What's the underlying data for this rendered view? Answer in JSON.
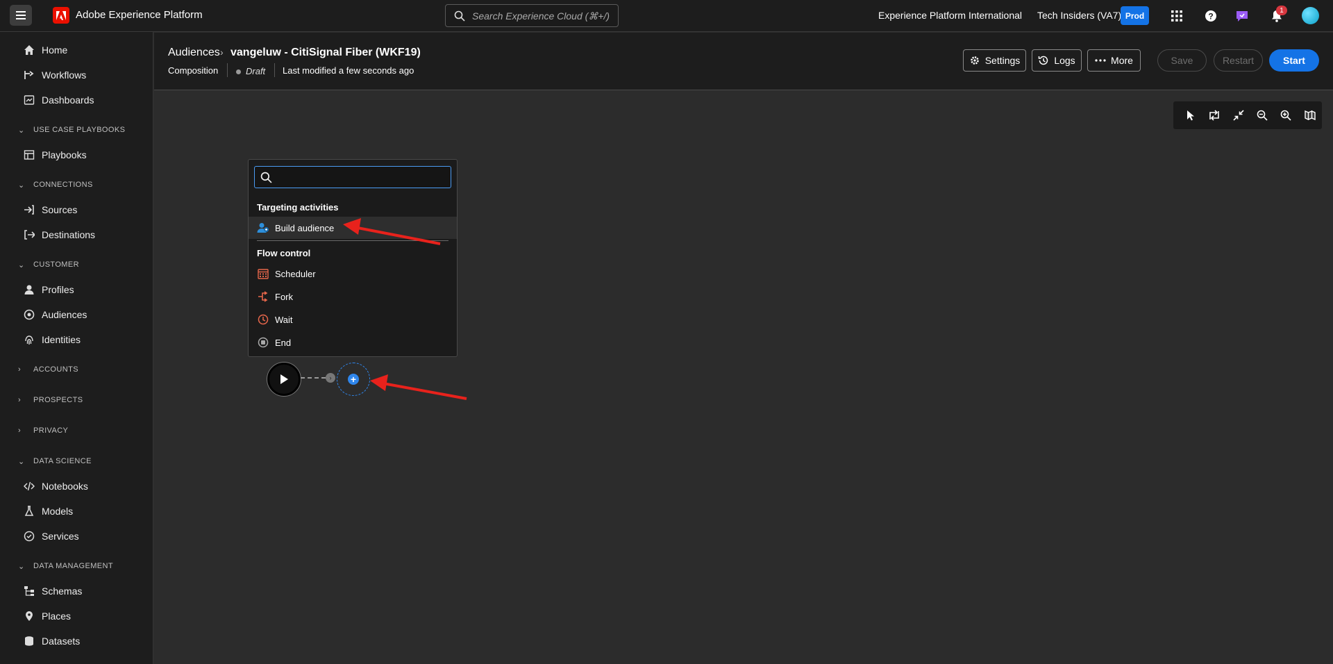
{
  "app": {
    "brand": "Adobe Experience Platform",
    "search_placeholder": "Search Experience Cloud (⌘+/)",
    "org": "Experience Platform International",
    "sandbox": "Tech Insiders (VA7)",
    "env_badge": "Prod",
    "notification_count": "1",
    "brand_color": "#eb1000",
    "accent_color": "#1473e6"
  },
  "sidebar": {
    "items": [
      {
        "label": "Home",
        "icon": "home-icon"
      },
      {
        "label": "Workflows",
        "icon": "workflow-icon"
      },
      {
        "label": "Dashboards",
        "icon": "dashboard-icon"
      },
      {
        "section": "USE CASE PLAYBOOKS",
        "expanded": true
      },
      {
        "label": "Playbooks",
        "icon": "playbook-icon"
      },
      {
        "section": "CONNECTIONS",
        "expanded": true
      },
      {
        "label": "Sources",
        "icon": "sources-icon"
      },
      {
        "label": "Destinations",
        "icon": "destinations-icon"
      },
      {
        "section": "CUSTOMER",
        "expanded": true
      },
      {
        "label": "Profiles",
        "icon": "profile-icon"
      },
      {
        "label": "Audiences",
        "icon": "audiences-icon"
      },
      {
        "label": "Identities",
        "icon": "fingerprint-icon"
      },
      {
        "section": "ACCOUNTS",
        "expanded": false
      },
      {
        "section": "PROSPECTS",
        "expanded": false
      },
      {
        "section": "PRIVACY",
        "expanded": false
      },
      {
        "section": "DATA SCIENCE",
        "expanded": true
      },
      {
        "label": "Notebooks",
        "icon": "code-icon"
      },
      {
        "label": "Models",
        "icon": "flask-icon"
      },
      {
        "label": "Services",
        "icon": "services-icon"
      },
      {
        "section": "DATA MANAGEMENT",
        "expanded": true
      },
      {
        "label": "Schemas",
        "icon": "schema-icon"
      },
      {
        "label": "Places",
        "icon": "pin-icon"
      },
      {
        "label": "Datasets",
        "icon": "datasets-icon"
      }
    ]
  },
  "header": {
    "breadcrumb_parent": "Audiences",
    "title": "vangeluw - CitiSignal Fiber (WKF19)",
    "type": "Composition",
    "status": "Draft",
    "modified": "Last modified a few seconds ago",
    "settings_label": "Settings",
    "logs_label": "Logs",
    "more_label": "More",
    "save_label": "Save",
    "restart_label": "Restart",
    "start_label": "Start"
  },
  "popover": {
    "search_value": "",
    "group1": "Targeting activities",
    "build_audience": "Build audience",
    "group2": "Flow control",
    "scheduler": "Scheduler",
    "fork": "Fork",
    "wait": "Wait",
    "end": "End"
  }
}
